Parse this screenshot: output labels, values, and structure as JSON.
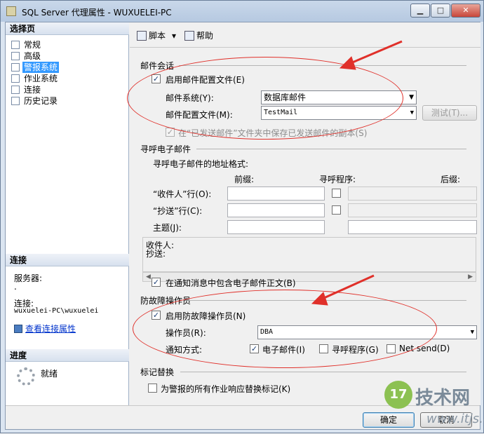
{
  "window": {
    "title": "SQL Server 代理属性 - WUXUELEI-PC"
  },
  "left": {
    "select_page_header": "选择页",
    "pages": [
      "常规",
      "高级",
      "警报系统",
      "作业系统",
      "连接",
      "历史记录"
    ],
    "selected_page": "警报系统",
    "connection_header": "连接",
    "server_label": "服务器:",
    "server_value": ".",
    "connection_label": "连接:",
    "connection_value": "wuxuelei-PC\\wuxuelei",
    "view_connection_link": "查看连接属性",
    "progress_header": "进度",
    "progress_status": "就绪"
  },
  "toolbar": {
    "script_label": "脚本",
    "help_label": "帮助"
  },
  "mail_session": {
    "title": "邮件会话",
    "enable_profile_label": "启用邮件配置文件(E)",
    "enable_profile_checked": true,
    "mail_system_label": "邮件系统(Y):",
    "mail_system_value": "数据库邮件",
    "mail_profile_label": "邮件配置文件(M):",
    "mail_profile_value": "TestMail",
    "test_button": "测试(T)...",
    "save_copies_label": "在“已发送邮件”文件夹中保存已发送邮件的副本(S)",
    "save_copies_checked": true
  },
  "pager": {
    "title": "寻呼电子邮件",
    "address_format_label": "寻呼电子邮件的地址格式:",
    "col_prefix": "前缀:",
    "col_pager": "寻呼程序:",
    "col_suffix": "后缀:",
    "to_row_label": "“收件人”行(O):",
    "cc_row_label": "“抄送”行(C):",
    "subject_label": "主题(J):",
    "preview_to": "收件人:",
    "preview_cc": "抄送:",
    "include_body_label": "在通知消息中包含电子邮件正文(B)",
    "include_body_checked": true
  },
  "failsafe": {
    "title": "防故障操作员",
    "enable_label": "启用防故障操作员(N)",
    "enable_checked": true,
    "operator_label": "操作员(R):",
    "operator_value": "DBA",
    "notify_label": "通知方式:",
    "notify_email": "电子邮件(I)",
    "notify_email_checked": true,
    "notify_pager": "寻呼程序(G)",
    "notify_pager_checked": false,
    "notify_netsend": "Net send(D)",
    "notify_netsend_checked": false
  },
  "token_replace": {
    "title": "标记替换",
    "replace_label": "为警报的所有作业响应替换标记(K)",
    "replace_checked": false
  },
  "buttons": {
    "ok": "确定",
    "cancel": "取消"
  },
  "watermark": {
    "badge": "17",
    "text": "技术网",
    "url": "www.itjs.cn"
  },
  "colors": {
    "annotation": "#e0302a",
    "selection": "#3399ff",
    "link": "#0033cc"
  }
}
